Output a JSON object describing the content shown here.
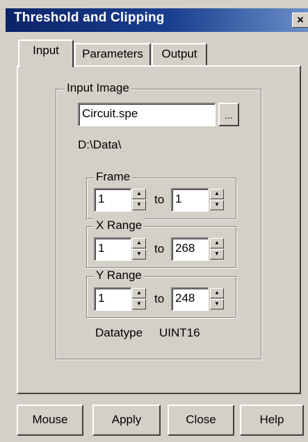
{
  "window": {
    "title": "Threshold and Clipping",
    "close_symbol": "×"
  },
  "tabs": [
    {
      "label": "Input",
      "active": true
    },
    {
      "label": "Parameters",
      "active": false
    },
    {
      "label": "Output",
      "active": false
    }
  ],
  "input_image": {
    "group_label": "Input Image",
    "file_name": "Circuit.spe",
    "browse_label": "...",
    "path": "D:\\Data\\"
  },
  "frame": {
    "group_label": "Frame",
    "from": "1",
    "to_label": "to",
    "to": "1"
  },
  "x_range": {
    "group_label": "X Range",
    "from": "1",
    "to_label": "to",
    "to": "268"
  },
  "y_range": {
    "group_label": "Y Range",
    "from": "1",
    "to_label": "to",
    "to": "248"
  },
  "datatype": {
    "label": "Datatype",
    "value": "UINT16"
  },
  "buttons": {
    "mouse": "Mouse",
    "apply": "Apply",
    "close": "Close",
    "help": "Help"
  },
  "icons": {
    "spin_up": "up-arrow-icon",
    "spin_down": "down-arrow-icon"
  }
}
